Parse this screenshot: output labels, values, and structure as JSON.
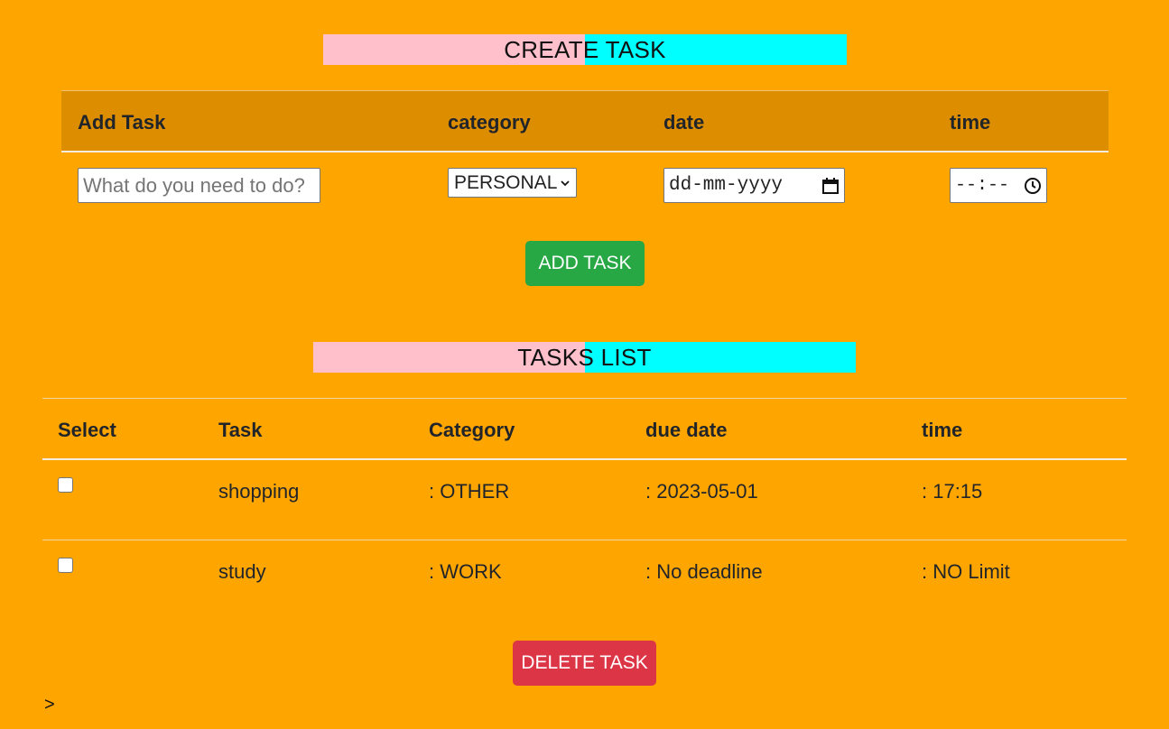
{
  "create": {
    "heading": "CREATE TASK",
    "columns": {
      "task": "Add Task",
      "category": "category",
      "date": "date",
      "time": "time"
    },
    "task_placeholder": "What do you need to do?",
    "task_value": "",
    "category_value": "PERSONAL",
    "date_placeholder": "dd-mm-yyyy",
    "time_placeholder": "--:--",
    "add_button": "ADD TASK"
  },
  "list": {
    "heading": "TASKS LIST",
    "columns": {
      "select": "Select",
      "task": "Task",
      "category": "Category",
      "due_date": "due date",
      "time": "time"
    },
    "rows": [
      {
        "checked": false,
        "task": "shopping",
        "category": ": OTHER",
        "due_date": ": 2023-05-01",
        "time": ": 17:15"
      },
      {
        "checked": false,
        "task": "study",
        "category": ": WORK",
        "due_date": ": No deadline",
        "time": ": NO Limit"
      }
    ],
    "delete_button": "DELETE TASK"
  },
  "footer_mark": ">",
  "colors": {
    "background": "#ffa500",
    "header_fill": "#dc8d00",
    "heading_left": "#ffc0cb",
    "heading_right": "#00ffff",
    "add_button": "#28a745",
    "delete_button": "#dc3545"
  },
  "icons": {
    "select_arrow": "chevron-down-icon",
    "date": "calendar-icon",
    "time": "clock-icon"
  }
}
